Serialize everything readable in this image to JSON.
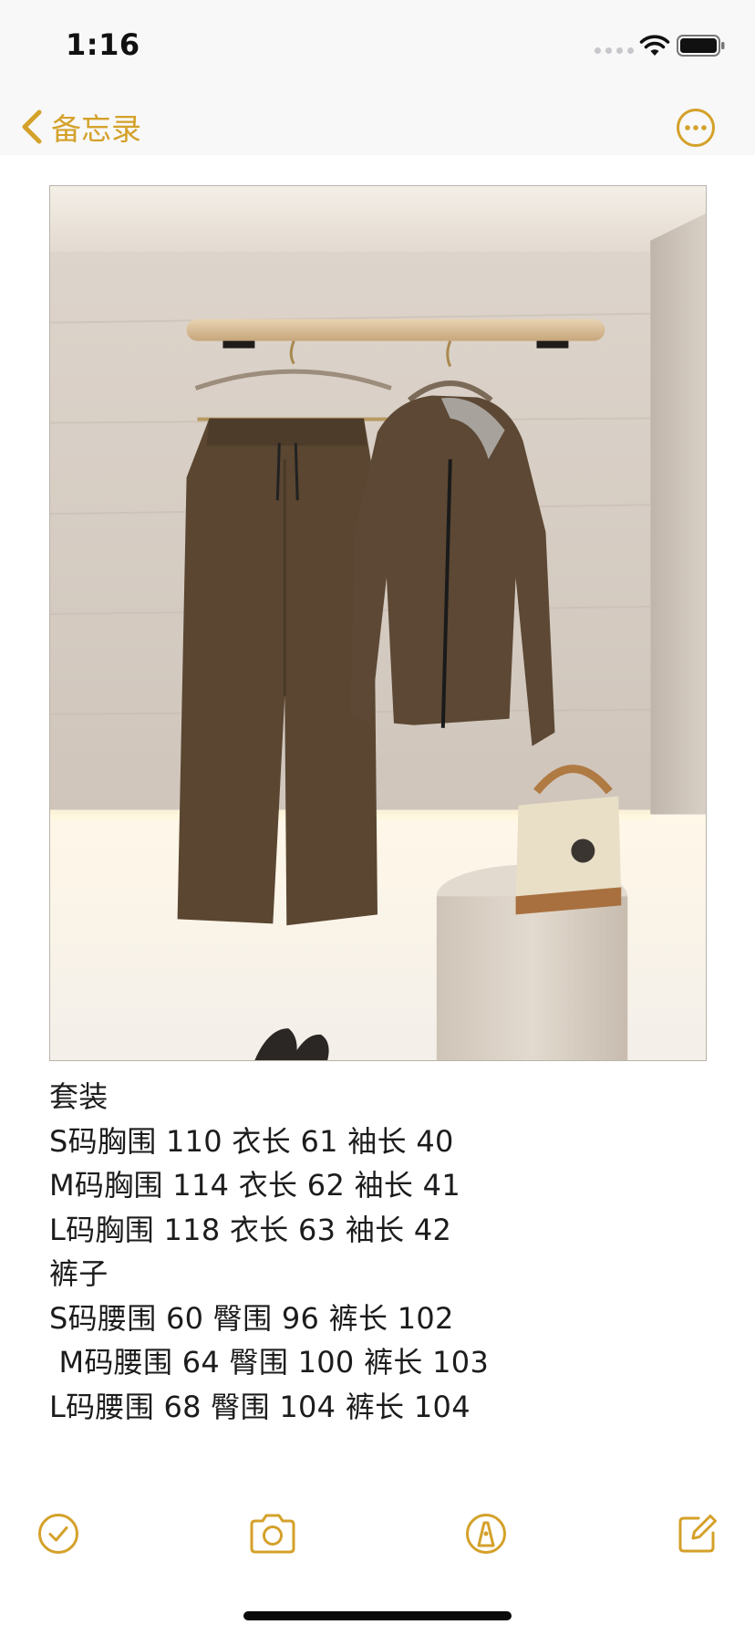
{
  "status_bar": {
    "time": "1:16"
  },
  "nav": {
    "back_label": "备忘录",
    "back_icon": "chevron-left-icon",
    "more_icon": "ellipsis-circle-icon"
  },
  "colors": {
    "accent": "#d4a12a",
    "background": "#ffffff",
    "bar_background": "#f8f8f8",
    "text": "#1c1c1e"
  },
  "photo": {
    "icon": "clothing-photo"
  },
  "note": {
    "lines": [
      "套装",
      "S码胸围 110 衣长 61 袖长 40",
      "M码胸围 114 衣长 62 袖长 41",
      "L码胸围 118 衣长 63 袖长 42",
      "裤子",
      "S码腰围 60 臀围 96 裤长 102",
      " M码腰围 64 臀围 100 裤长 103",
      "L码腰围 68 臀围 104 裤长 104"
    ]
  },
  "toolbar": {
    "checklist_icon": "checkmark-circle-icon",
    "camera_icon": "camera-icon",
    "markup_icon": "pen-tip-circle-icon",
    "compose_icon": "compose-icon"
  }
}
